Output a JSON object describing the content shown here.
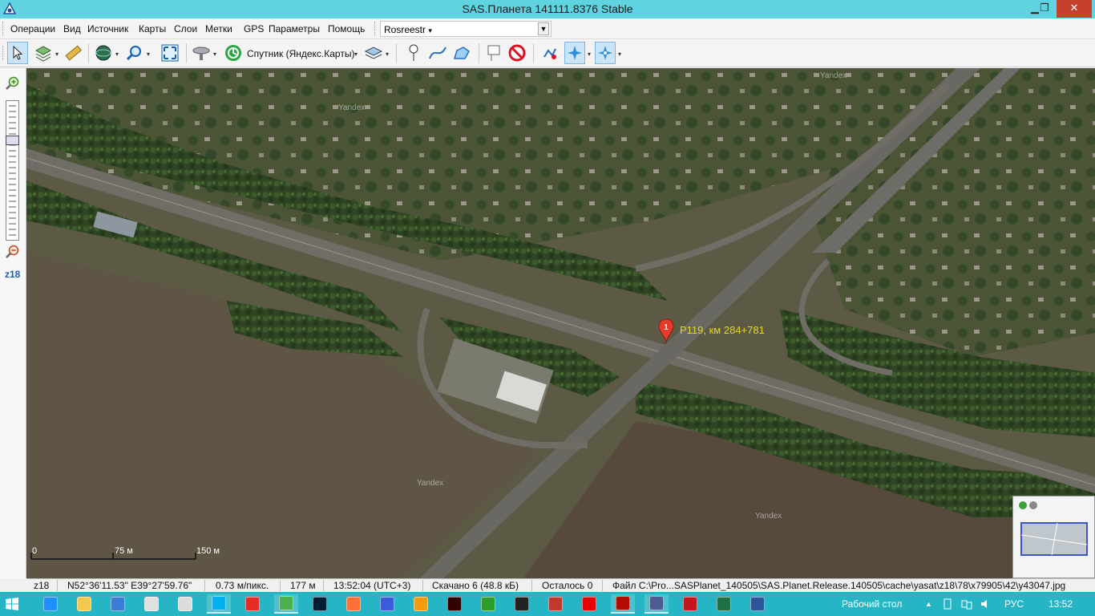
{
  "window": {
    "title": "SAS.Планета 141111.8376 Stable",
    "minimize": "▁",
    "maximize": "❐",
    "close": "✕"
  },
  "menu": {
    "items": [
      "Операции",
      "Вид",
      "Источник",
      "Карты",
      "Слои",
      "Метки",
      "GPS",
      "Параметры",
      "Помощь"
    ],
    "source_value": "Rosreestr",
    "source_arrow": "▾",
    "combo_arrow": "▼"
  },
  "toolbar": {
    "map_name": "Спутник (Яндекс.Карты)",
    "dropdown_arrow": "▾",
    "icons": [
      "cursor-icon",
      "map-layers-icon",
      "ruler-icon",
      "globe-icon",
      "zoom-magnifier-icon",
      "fullscreen-icon",
      "satellite-icon",
      "yandex-satellite-icon",
      "layers-icon",
      "add-placemark-icon",
      "add-path-icon",
      "add-polygon-icon",
      "mark-info-icon",
      "remove-marks-icon",
      "gps-connect-icon",
      "gps-track-icon",
      "gps-center-icon"
    ],
    "active_tools": [
      "cursor",
      "gps-track",
      "gps-center"
    ]
  },
  "left_panel": {
    "zoom_in": "zoom-in-icon",
    "zoom_out": "zoom-out-icon",
    "zoom_level": "z18",
    "zoom_slider_fraction": 0.27
  },
  "map": {
    "watermarks": [
      "Yandex",
      "Yandex",
      "Yandex",
      "Yandex"
    ],
    "marker_label": "Р119, км 284+781",
    "marker_icon": "map-pin-icon",
    "scale": [
      "0",
      "75 м",
      "150 м"
    ]
  },
  "status": {
    "zoom": "z18",
    "coords": "N52°36'11.53\" E39°27'59.76\"",
    "resolution": "0.73 м/пикс.",
    "distance": "177 м",
    "time": "13:52:04 (UTC+3)",
    "downloaded": "Скачано 6 (48.8 кБ)",
    "remaining": "Осталось 0",
    "file": "Файл C:\\Pro...SASPlanet_140505\\SAS.Planet.Release.140505\\cache\\yasat\\z18\\78\\x79905\\42\\y43047.jpg"
  },
  "taskbar": {
    "apps": [
      "start-icon",
      "ie-icon",
      "explorer-icon",
      "calculator-icon",
      "notepad-icon",
      "file-icon",
      "skype-icon",
      "youtube-icon",
      "chrome-icon",
      "photoshop-icon",
      "firefox-icon",
      "windows-app-icon",
      "audio-icon",
      "illustrator-icon",
      "cmd-app-icon",
      "typography-icon",
      "word-app-icon",
      "yandex-browser-icon",
      "acrobat-icon",
      "sasplanet-icon",
      "antivirus-icon",
      "excel-icon",
      "word-icon"
    ],
    "tray_label": "Рабочий стол",
    "tray_up": "▲",
    "language": "РУС",
    "clock": "13:52"
  },
  "colors": {
    "titlebar": "#5fd3e0",
    "taskbar": "#26b5c4",
    "close_button": "#c7402d",
    "marker": "#e53b2c",
    "marker_label": "#e6d81c"
  }
}
